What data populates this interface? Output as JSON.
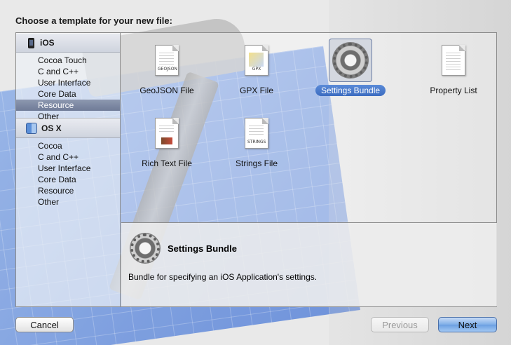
{
  "dialog": {
    "title": "Choose a template for your new file:"
  },
  "sidebar": {
    "sections": [
      {
        "name": "iOS",
        "icon": "iphone-icon",
        "items": [
          "Cocoa Touch",
          "C and C++",
          "User Interface",
          "Core Data",
          "Resource",
          "Other"
        ]
      },
      {
        "name": "OS X",
        "icon": "finder-icon",
        "items": [
          "Cocoa",
          "C and C++",
          "User Interface",
          "Core Data",
          "Resource",
          "Other"
        ]
      }
    ],
    "selected_item": "Resource",
    "selected_section": "iOS"
  },
  "templates": [
    {
      "label": "GeoJSON File",
      "icon": "geojson-file-icon",
      "tag": "GEOJSON"
    },
    {
      "label": "GPX File",
      "icon": "gpx-file-icon",
      "tag": "GPX"
    },
    {
      "label": "Settings Bundle",
      "icon": "settings-gear-icon",
      "selected": true
    },
    {
      "label": "Property List",
      "icon": "property-list-file-icon"
    },
    {
      "label": "Rich Text File",
      "icon": "rich-text-file-icon"
    },
    {
      "label": "Strings File",
      "icon": "strings-file-icon",
      "tag": "STRINGS"
    }
  ],
  "detail": {
    "title": "Settings Bundle",
    "description": "Bundle for specifying an iOS Application's settings."
  },
  "buttons": {
    "cancel": "Cancel",
    "previous": "Previous",
    "next": "Next"
  },
  "colors": {
    "selection": "#3c6cc0",
    "sidebar_selection": "#7480a0"
  }
}
